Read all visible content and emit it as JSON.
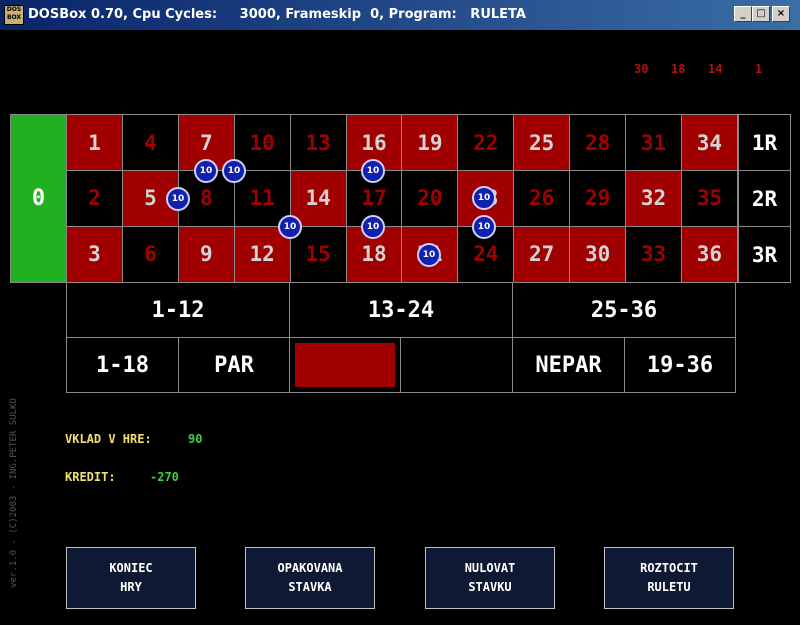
{
  "window": {
    "title": "DOSBox 0.70, Cpu Cycles:     3000, Frameskip  0, Program:   RULETA",
    "icon_text": "DOS BOX",
    "min": "_",
    "max": "□",
    "close": "×"
  },
  "last_numbers": [
    "30",
    "18",
    "14",
    "1"
  ],
  "table": {
    "zero": "0",
    "rows": [
      [
        "1",
        "4",
        "7",
        "10",
        "13",
        "16",
        "19",
        "22",
        "25",
        "28",
        "31",
        "34"
      ],
      [
        "2",
        "5",
        "8",
        "11",
        "14",
        "17",
        "20",
        "23",
        "26",
        "29",
        "32",
        "35"
      ],
      [
        "3",
        "6",
        "9",
        "12",
        "15",
        "18",
        "21",
        "24",
        "27",
        "30",
        "33",
        "36"
      ]
    ],
    "colors": [
      [
        "red",
        "black",
        "red",
        "black",
        "black",
        "red",
        "red",
        "black",
        "red",
        "black",
        "black",
        "red"
      ],
      [
        "black",
        "red",
        "black",
        "black",
        "red",
        "black",
        "black",
        "red",
        "black",
        "black",
        "red",
        "black"
      ],
      [
        "red",
        "black",
        "red",
        "red",
        "black",
        "red",
        "red",
        "black",
        "red",
        "red",
        "black",
        "red"
      ]
    ],
    "row_labels": [
      "1R",
      "2R",
      "3R"
    ],
    "dozens": [
      "1-12",
      "13-24",
      "25-36"
    ],
    "outside": {
      "low": "1-18",
      "even": "PAR",
      "odd": "NEPAR",
      "high": "19-36"
    }
  },
  "chips": [
    {
      "value": "10",
      "target": "7"
    },
    {
      "value": "10",
      "target": "7-10"
    },
    {
      "value": "10",
      "target": "16"
    },
    {
      "value": "10",
      "target": "5-8"
    },
    {
      "value": "10",
      "target": "20-23"
    },
    {
      "value": "10",
      "target": "11-12-14-15"
    },
    {
      "value": "10",
      "target": "17-18"
    },
    {
      "value": "10",
      "target": "23-24"
    },
    {
      "value": "10",
      "target": "21"
    }
  ],
  "info": {
    "stake_label": "VKLAD V HRE:",
    "stake_value": "90",
    "credit_label": "KREDIT:",
    "credit_value": "-270"
  },
  "credits_text": "ver.1.0 - (C)2003 - ING.PETER SULKO",
  "buttons": [
    {
      "line1": "KONIEC",
      "line2": "HRY"
    },
    {
      "line1": "OPAKOVANA",
      "line2": "STAVKA"
    },
    {
      "line1": "NULOVAT",
      "line2": "STAVKU"
    },
    {
      "line1": "ROZTOCIT",
      "line2": "RULETU"
    }
  ],
  "accent_colors": {
    "red": "#a00000",
    "green": "#20b020",
    "chip": "#1020b0"
  }
}
